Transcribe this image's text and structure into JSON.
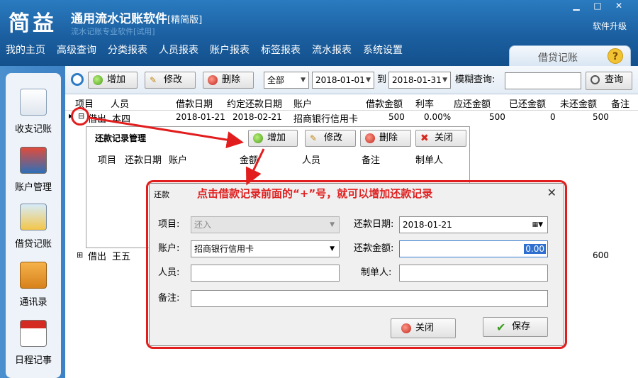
{
  "header": {
    "logo": "简益",
    "title": "通用流水记账软件",
    "edition": "[精简版]",
    "watermark": "流水记账专业软件[试用]",
    "upgrade": "软件升级",
    "win_min": "▁",
    "win_max": "□",
    "win_close": "✕"
  },
  "menu": [
    "我的主页",
    "高级查询",
    "分类报表",
    "人员报表",
    "账户报表",
    "标签报表",
    "流水报表",
    "系统设置"
  ],
  "module_tab": {
    "label": "借贷记账",
    "help": "?"
  },
  "sidebar": [
    "收支记账",
    "账户管理",
    "借贷记账",
    "通讯录",
    "日程记事"
  ],
  "toolbar": {
    "add": "增加",
    "edit": "修改",
    "delete": "删除",
    "filter": "全部",
    "date_from": "2018-01-01",
    "to": "到",
    "date_to": "2018-01-31",
    "fuzzy": "模糊查询:",
    "search_value": "",
    "query": "查询"
  },
  "columns": [
    "项目",
    "人员",
    "借款日期",
    "约定还款日期",
    "账户",
    "借款金额",
    "利率",
    "应还金额",
    "已还金额",
    "未还金额",
    "备注"
  ],
  "rows": [
    {
      "toggle": "⊟",
      "item": "借出",
      "person": "本四",
      "date": "2018-01-21",
      "due": "2018-02-21",
      "account": "招商银行信用卡",
      "amount": "500",
      "rate": "0.00%",
      "payable": "500",
      "paid": "0",
      "unpaid": "500"
    },
    {
      "toggle": "⊞",
      "item": "借出",
      "person": "王五",
      "unpaid": "600"
    }
  ],
  "sub": {
    "title": "还款记录管理",
    "add": "增加",
    "edit": "修改",
    "delete": "删除",
    "close": "关闭",
    "columns": [
      "项目",
      "还款日期",
      "账户",
      "金额",
      "人员",
      "备注",
      "制单人"
    ]
  },
  "callout": "点击借款记录前面的“+”号，就可以增加还款记录",
  "dialog": {
    "title": "还款",
    "close": "✕",
    "item_label": "项目:",
    "item_value": "还入",
    "date_label": "还款日期:",
    "date_value": "2018-01-21",
    "account_label": "账户:",
    "account_value": "招商银行信用卡",
    "amount_label": "还款金额:",
    "amount_value": "0.00",
    "person_label": "人员:",
    "person_value": "",
    "maker_label": "制单人:",
    "maker_value": "",
    "memo_label": "备注:",
    "memo_value": "",
    "close_btn": "关闭",
    "save_btn": "保存"
  },
  "colors": {
    "accent": "#1b5fa0",
    "highlight": "#e21d1d"
  }
}
